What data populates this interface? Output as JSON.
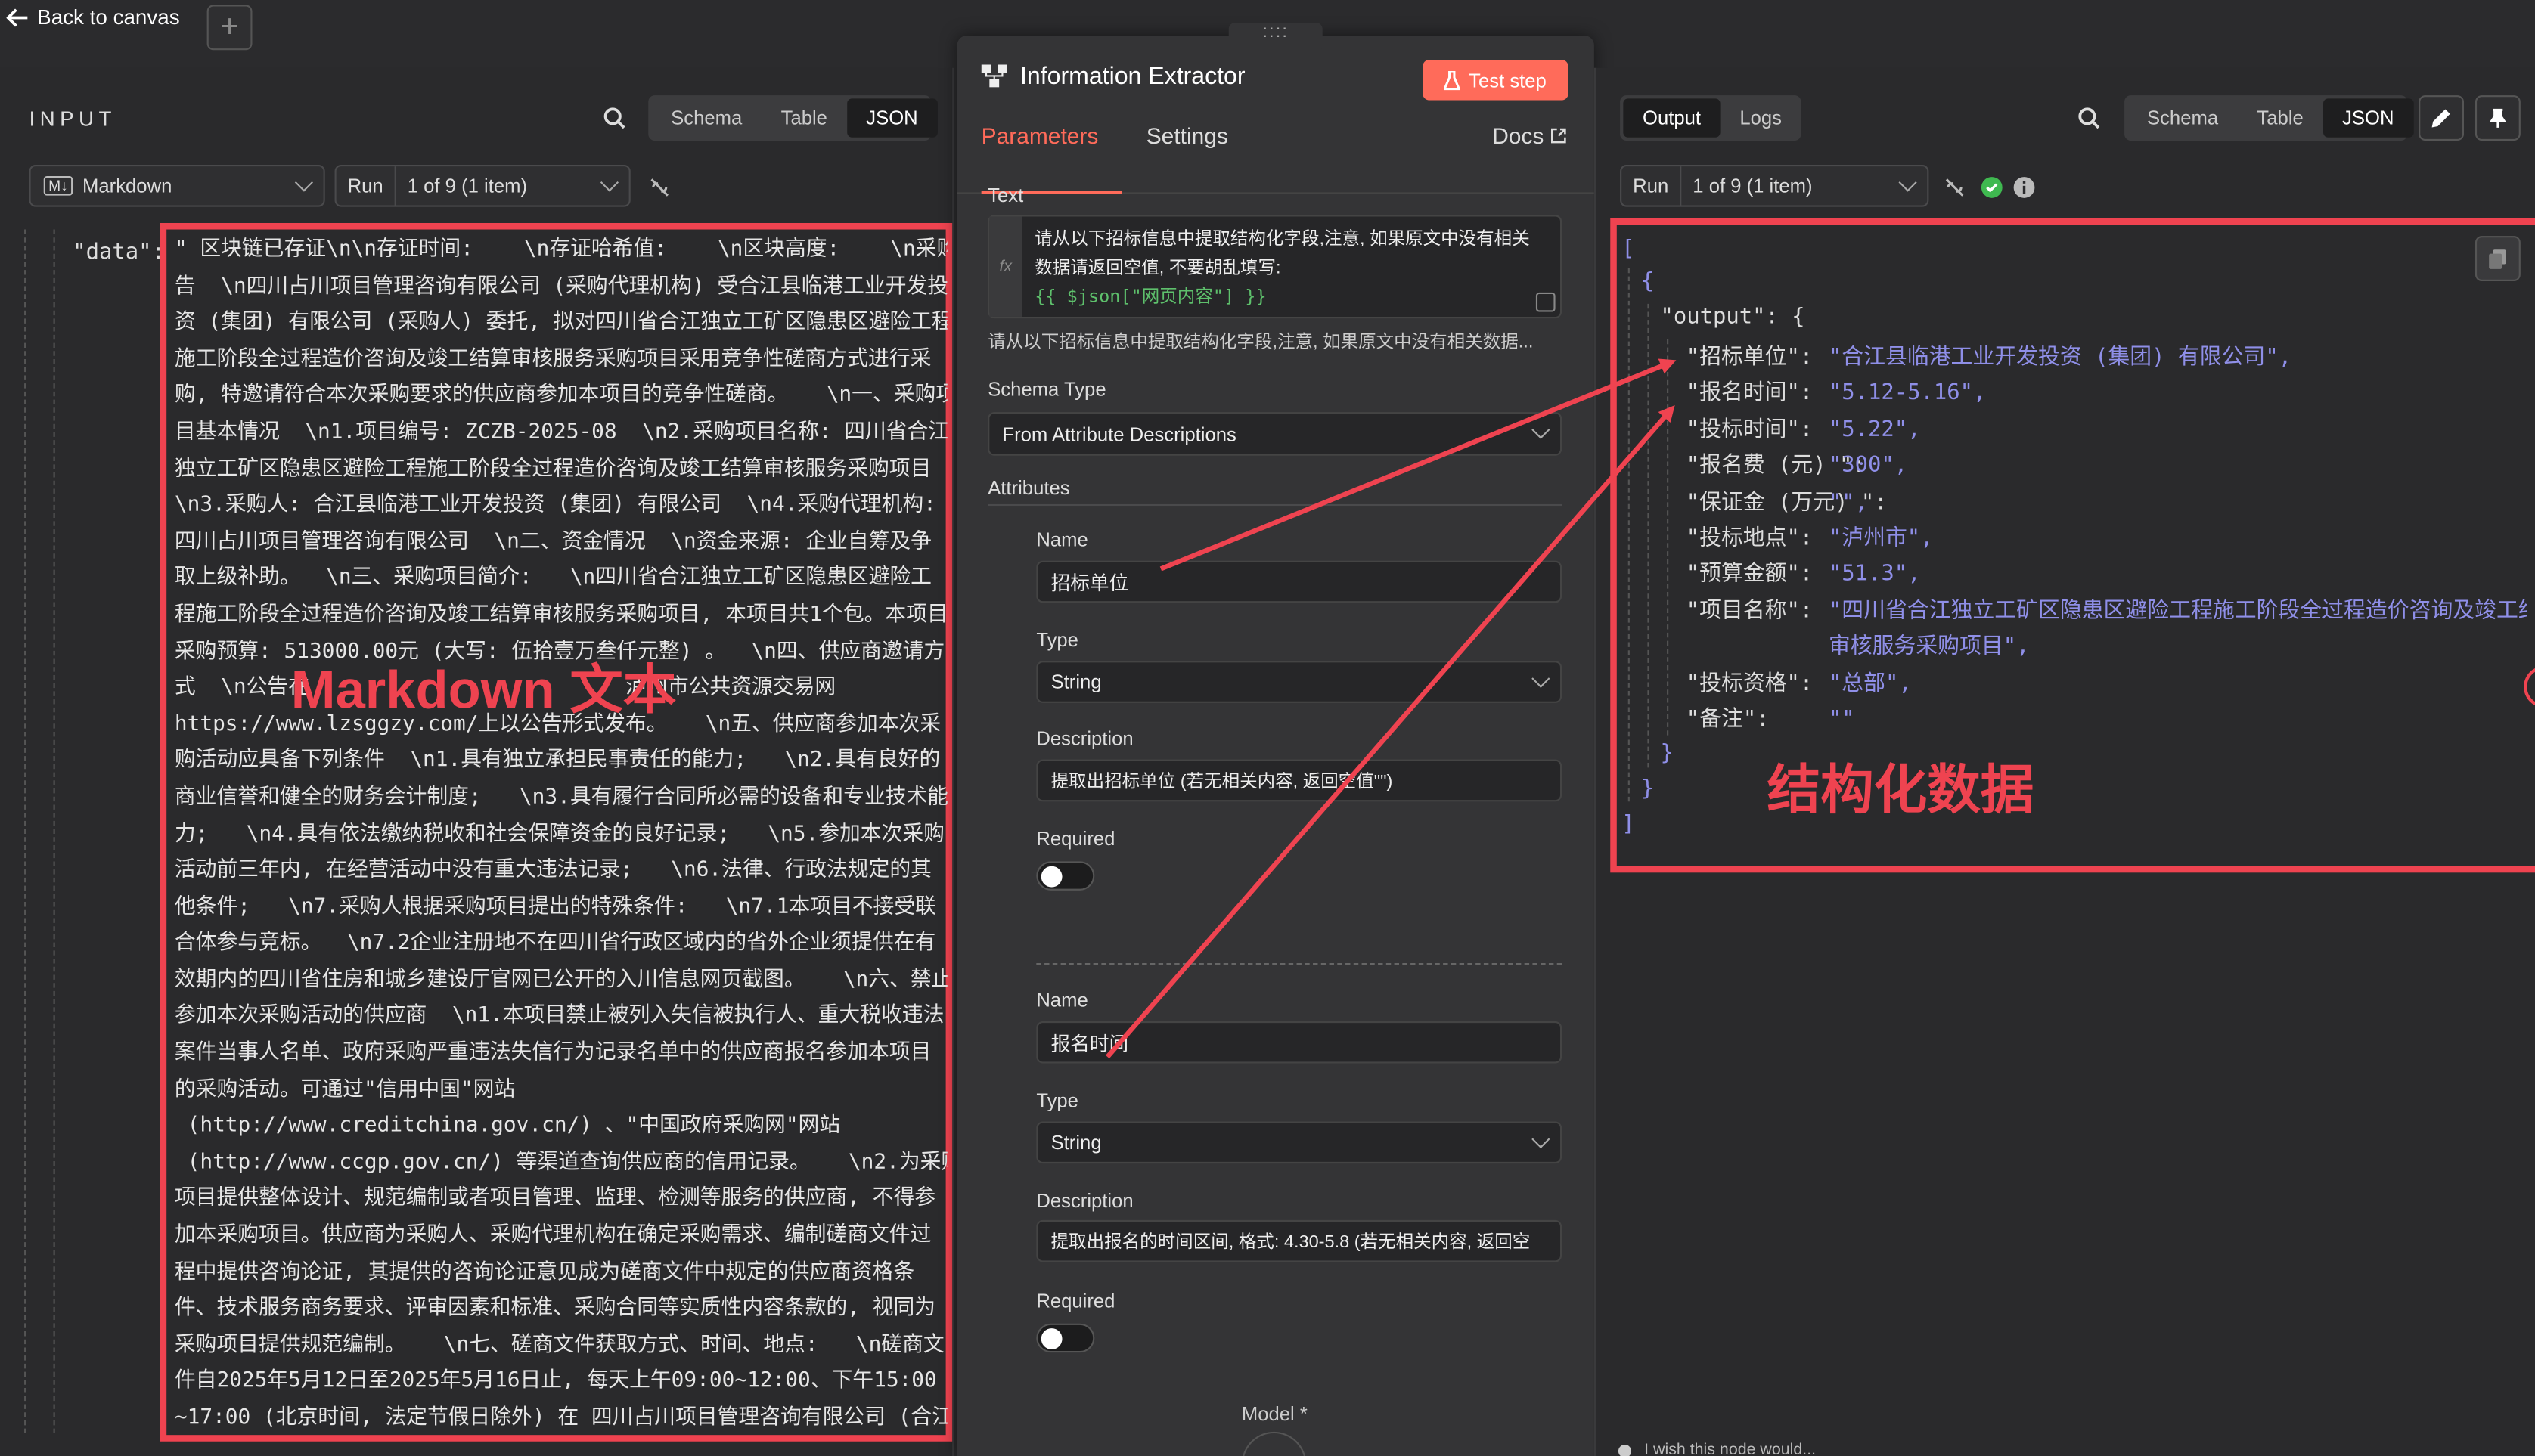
{
  "topbar": {
    "back_label": "Back to canvas",
    "add_icon": "plus-icon"
  },
  "input_panel": {
    "title": "INPUT",
    "view_tabs": [
      "Schema",
      "Table",
      "JSON"
    ],
    "active_view": "JSON",
    "format_select": "Markdown",
    "run_label": "Run",
    "run_select": "1 of 9 (1 item)",
    "data_key": "\"data\":",
    "data_lines": [
      "\" 区块链已存证\\n\\n存证时间:    \\n存证哈希值:    \\n区块高度:    \\n采购公",
      "告  \\n四川占川项目管理咨询有限公司 (采购代理机构) 受合江县临港工业开发投",
      "资 (集团) 有限公司 (采购人) 委托, 拟对四川省合江独立工矿区隐患区避险工程",
      "施工阶段全过程造价咨询及竣工结算审核服务采购项目采用竞争性磋商方式进行采",
      "购, 特邀请符合本次采购要求的供应商参加本项目的竞争性磋商。   \\n一、采购项",
      "目基本情况  \\n1.项目编号: ZCZB-2025-08  \\n2.采购项目名称: 四川省合江",
      "独立工矿区隐患区避险工程施工阶段全过程造价咨询及竣工结算审核服务采购项目",
      "\\n3.采购人: 合江县临港工业开发投资 (集团) 有限公司  \\n4.采购代理机构:",
      "四川占川项目管理咨询有限公司  \\n二、资金情况  \\n资金来源: 企业自筹及争",
      "取上级补助。  \\n三、采购项目简介:   \\n四川省合江独立工矿区隐患区避险工",
      "程施工阶段全过程造价咨询及竣工结算审核服务采购项目, 本项目共1个包。本项目",
      "采购预算: 513000.00元 (大写: 伍拾壹万叁仟元整) 。  \\n四、供应商邀请方",
      "式  \\n公告在                         泸州市公共资源交易网",
      "https://www.lzsggzy.com/上以公告形式发布。   \\n五、供应商参加本次采",
      "购活动应具备下列条件  \\n1.具有独立承担民事责任的能力;   \\n2.具有良好的",
      "商业信誉和健全的财务会计制度;   \\n3.具有履行合同所必需的设备和专业技术能",
      "力;   \\n4.具有依法缴纳税收和社会保障资金的良好记录;   \\n5.参加本次采购",
      "活动前三年内, 在经营活动中没有重大违法记录;   \\n6.法律、行政法规定的其",
      "他条件;   \\n7.采购人根据采购项目提出的特殊条件:   \\n7.1本项目不接受联",
      "合体参与竞标。  \\n7.2企业注册地不在四川省行政区域内的省外企业须提供在有",
      "效期内的四川省住房和城乡建设厅官网已公开的入川信息网页截图。   \\n六、禁止",
      "参加本次采购活动的供应商  \\n1.本项目禁止被列入失信被执行人、重大税收违法",
      "案件当事人名单、政府采购严重违法失信行为记录名单中的供应商报名参加本项目",
      "的采购活动。可通过\"信用中国\"网站",
      " (http://www.creditchina.gov.cn/) 、\"中国政府采购网\"网站",
      " (http://www.ccgp.gov.cn/) 等渠道查询供应商的信用记录。   \\n2.为采购",
      "项目提供整体设计、规范编制或者项目管理、监理、检测等服务的供应商, 不得参",
      "加本采购项目。供应商为采购人、采购代理机构在确定采购需求、编制磋商文件过",
      "程中提供咨询论证, 其提供的咨询论证意见成为磋商文件中规定的供应商资格条",
      "件、技术服务商务要求、评审因素和标准、采购合同等实质性内容条款的, 视同为",
      "采购项目提供规范编制。   \\n七、磋商文件获取方式、时间、地点:   \\n磋商文",
      "件自2025年5月12日至2025年5月16日止, 每天上午09:00~12:00、下午15:00",
      "~17:00 (北京时间, 法定节假日除外) 在 四川占川项目管理咨询有限公司 (合江"
    ],
    "annotation": "Markdown 文本"
  },
  "node_panel": {
    "drag_handle": "::::",
    "title": "Information Extractor",
    "test_button": "Test step",
    "tabs": [
      "Parameters",
      "Settings"
    ],
    "active_tab": "Parameters",
    "docs_label": "Docs",
    "text_label": "Text",
    "text_lines": [
      "请从以下招标信息中提取结构化字段,注意, 如果原文中没有相关",
      "数据请返回空值, 不要胡乱填写:"
    ],
    "text_expression": "{{ $json[\"网页内容\"] }}",
    "text_preview": "请从以下招标信息中提取结构化字段,注意, 如果原文中没有相关数据...",
    "fx_label": "fx",
    "schema_type_label": "Schema Type",
    "schema_type_value": "From Attribute Descriptions",
    "attributes_label": "Attributes",
    "attributes": [
      {
        "name_label": "Name",
        "name": "招标单位",
        "type_label": "Type",
        "type": "String",
        "desc_label": "Description",
        "description": "提取出招标单位 (若无相关内容, 返回空值\"\")",
        "required_label": "Required",
        "required": false
      },
      {
        "name_label": "Name",
        "name": "报名时间",
        "type_label": "Type",
        "type": "String",
        "desc_label": "Description",
        "description": "提取出报名的时间区间, 格式: 4.30-5.8 (若无相关内容, 返回空",
        "required_label": "Required",
        "required": false
      }
    ],
    "model_label": "Model *"
  },
  "output_panel": {
    "tabs": [
      "Output",
      "Logs"
    ],
    "active_tab": "Output",
    "view_tabs": [
      "Schema",
      "Table",
      "JSON"
    ],
    "active_view": "JSON",
    "run_label": "Run",
    "run_select": "1 of 9 (1 item)",
    "json": {
      "open": "[",
      "obj_open": "{",
      "output_key": "\"output\": {",
      "fields": [
        {
          "key": "\"招标单位\":",
          "value": "\"合江县临港工业开发投资 (集团) 有限公司\","
        },
        {
          "key": "\"报名时间\":",
          "value": "\"5.12-5.16\","
        },
        {
          "key": "\"投标时间\":",
          "value": "\"5.22\","
        },
        {
          "key": "\"报名费 (元) \":",
          "value": "\"300\","
        },
        {
          "key": "\"保证金 (万元) \":",
          "value": "\"\","
        },
        {
          "key": "\"投标地点\":",
          "value": "\"泸州市\","
        },
        {
          "key": "\"预算金额\":",
          "value": "\"51.3\","
        },
        {
          "key": "\"项目名称\":",
          "value": "\"四川省合江独立工矿区隐患区避险工程施工阶段全过程造价咨询及竣工结算"
        },
        {
          "key": "",
          "value": "审核服务采购项目\","
        },
        {
          "key": "\"投标资格\":",
          "value": "\"总部\","
        },
        {
          "key": "\"备注\":",
          "value": "\"\""
        }
      ],
      "output_close": "}",
      "obj_close": "}",
      "close": "]"
    },
    "annotation": "结构化数据",
    "footer_hint": "I wish this node would..."
  },
  "colors": {
    "accent": "#ff6b5a",
    "annotation_red": "#ef4350",
    "json_value": "#8f8fe8",
    "success": "#3fb950"
  }
}
